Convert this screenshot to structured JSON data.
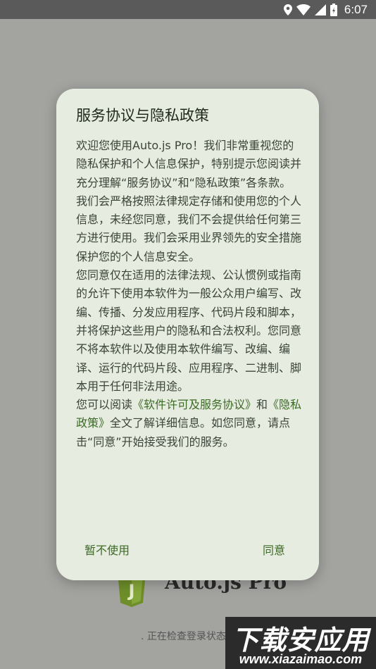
{
  "status_bar": {
    "time": "6:07",
    "icons": [
      "location-icon",
      "wifi-icon",
      "signal-icon",
      "battery-icon"
    ]
  },
  "background": {
    "app_name": "Auto.js Pro",
    "logo_letter": "J",
    "loading_text": ". 正在检查登录状态"
  },
  "watermark": {
    "main": "下载安应用",
    "url": "www.xiazaimao.com"
  },
  "dialog": {
    "title": "服务协议与隐私政策",
    "paragraphs": [
      "欢迎您使用Auto.js Pro！我们非常重视您的隐私保护和个人信息保护，特别提示您阅读并充分理解“服务协议”和“隐私政策”各条款。",
      "我们会严格按照法律规定存储和使用您的个人信息，未经您同意，我们不会提供给任何第三方进行使用。我们会采用业界领先的安全措施保护您的个人信息安全。",
      "您同意仅在适用的法律法规、公认惯例或指南的允许下使用本软件为一般公众用户编写、改编、传播、分发应用程序、代码片段和脚本，并将保护这些用户的隐私和合法权利。您同意不将本软件以及使用本软件编写、改编、编译、运行的代码片段、应用程序、二进制、脚本用于任何非法用途。"
    ],
    "last_paragraph": {
      "prefix": "您可以阅读",
      "link_license": "《软件许可及服务协议》",
      "and": "和",
      "link_privacy": "《隐私政策》",
      "suffix": "全文了解详细信息。如您同意，请点击“同意”开始接受我们的服务。"
    },
    "decline_label": "暂不使用",
    "agree_label": "同意"
  },
  "colors": {
    "dialog_bg": "#e6ecdf",
    "accent": "#3c6a26",
    "scrim": "#a3a3a0",
    "status_bar": "#5a5a5a"
  }
}
